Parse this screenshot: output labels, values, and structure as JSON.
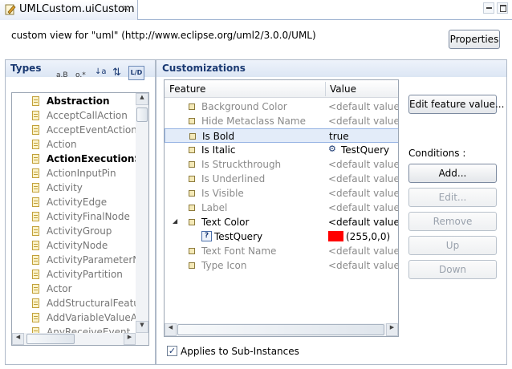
{
  "editor": {
    "tab_title": "UMLCustom.uiCustom",
    "tab_icon": "customization-file-icon",
    "close_glyph": "✕"
  },
  "header": {
    "description": "custom view for \"uml\" (http://www.eclipse.org/uml2/3.0.0/UML)",
    "properties_button": "Properties"
  },
  "types_panel": {
    "title": "Types",
    "toolbar": [
      {
        "icon": "sort-alpha-icon",
        "glyph": "a.B"
      },
      {
        "icon": "filter-instances-icon",
        "glyph": "o.*"
      },
      {
        "icon": "sort-az-icon",
        "glyph": "↓a"
      },
      {
        "icon": "hierarchy-icon",
        "glyph": "⇅"
      },
      {
        "icon": "show-derived-icon",
        "glyph": "L/D"
      }
    ],
    "items": [
      {
        "label": "Abstraction",
        "bold": true
      },
      {
        "label": "AcceptCallAction",
        "bold": false
      },
      {
        "label": "AcceptEventAction",
        "bold": false
      },
      {
        "label": "Action",
        "bold": false
      },
      {
        "label": "ActionExecutionSpe",
        "bold": true
      },
      {
        "label": "ActionInputPin",
        "bold": false
      },
      {
        "label": "Activity",
        "bold": false
      },
      {
        "label": "ActivityEdge",
        "bold": false
      },
      {
        "label": "ActivityFinalNode",
        "bold": false
      },
      {
        "label": "ActivityGroup",
        "bold": false
      },
      {
        "label": "ActivityNode",
        "bold": false
      },
      {
        "label": "ActivityParameterNo",
        "bold": false
      },
      {
        "label": "ActivityPartition",
        "bold": false
      },
      {
        "label": "Actor",
        "bold": false
      },
      {
        "label": "AddStructuralFeature",
        "bold": false
      },
      {
        "label": "AddVariableValueAct",
        "bold": false
      },
      {
        "label": "AnyReceiveEvent",
        "bold": false
      },
      {
        "label": "Artifact",
        "bold": false
      }
    ]
  },
  "customizations_panel": {
    "title": "Customizations",
    "columns": [
      "Feature",
      "Value"
    ],
    "rows": [
      {
        "feature": "Background Color",
        "value": "<default value>",
        "set": false
      },
      {
        "feature": "Hide Metaclass Name",
        "value": "<default value>",
        "set": false
      },
      {
        "feature": "Is Bold",
        "value": "true",
        "set": true,
        "selected": true
      },
      {
        "feature": "Is Italic",
        "value": "TestQuery",
        "set": true,
        "value_icon": "query-gear-icon"
      },
      {
        "feature": "Is Struckthrough",
        "value": "<default value>",
        "set": false
      },
      {
        "feature": "Is Underlined",
        "value": "<default value>",
        "set": false
      },
      {
        "feature": "Is Visible",
        "value": "<default value>",
        "set": false
      },
      {
        "feature": "Label",
        "value": "<default value>",
        "set": false
      },
      {
        "feature": "Text Color",
        "value": "<default value>",
        "set": true,
        "expanded": true
      },
      {
        "feature": "TestQuery",
        "value": "(255,0,0)",
        "set": true,
        "child": true,
        "swatch": "#ff0000"
      },
      {
        "feature": "Text Font Name",
        "value": "<default value>",
        "set": false
      },
      {
        "feature": "Type Icon",
        "value": "<default value>",
        "set": false
      }
    ],
    "edit_feature_button": "Edit feature value...",
    "conditions_label": "Conditions :",
    "condition_buttons": [
      {
        "label": "Add...",
        "enabled": true
      },
      {
        "label": "Edit...",
        "enabled": false
      },
      {
        "label": "Remove",
        "enabled": false
      },
      {
        "label": "Up",
        "enabled": false
      },
      {
        "label": "Down",
        "enabled": false
      }
    ],
    "applies_checkbox": {
      "label": "Applies to Sub-Instances",
      "checked": true
    }
  },
  "colors": {
    "panel_title": "#1b3a73",
    "selection": "#e3ecf9",
    "text_color_swatch": "#ff0000"
  }
}
